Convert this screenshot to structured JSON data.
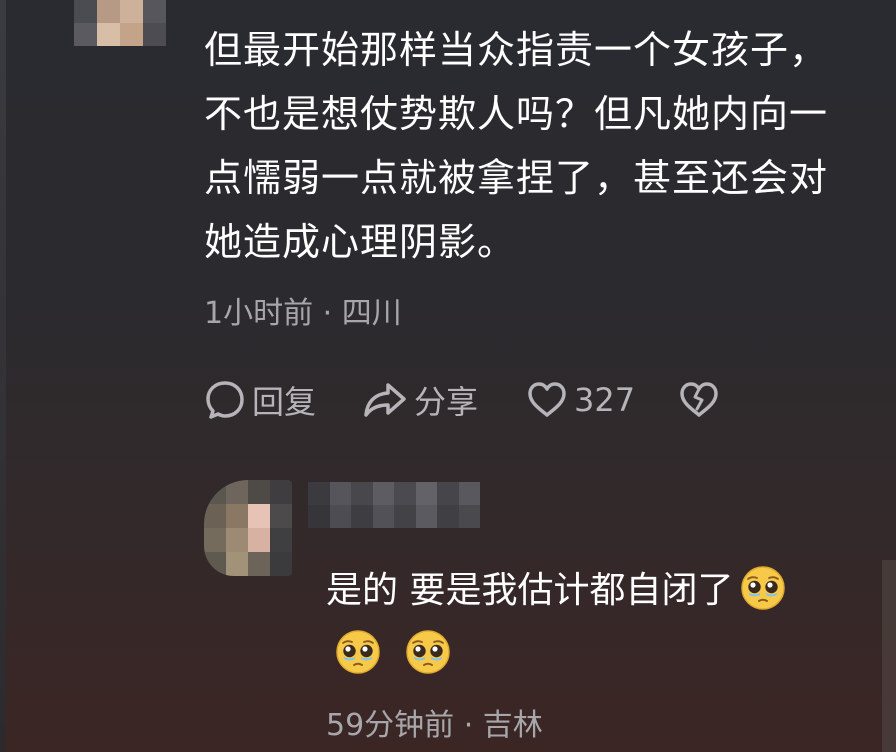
{
  "comment": {
    "text": "但最开始那样当众指责一个女孩子，不也是想仗势欺人吗？但凡她内向一点懦弱一点就被拿捏了，甚至还会对她造成心理阴影。",
    "meta": "1小时前 · 四川",
    "actions": {
      "reply_label": "回复",
      "share_label": "分享",
      "like_count": "327"
    },
    "icons": {
      "reply": "speech-bubble-icon",
      "share": "share-arrow-icon",
      "like": "heart-icon",
      "dislike": "broken-heart-icon"
    }
  },
  "reply": {
    "text": "是的 要是我估计都自闭了",
    "emoji": "pleading-face-emoji",
    "meta": "59分钟前 · 吉林"
  },
  "colors": {
    "text_primary": "#ffffff",
    "text_secondary": "#a7a7ab",
    "emoji_yellow": "#f7c948"
  }
}
